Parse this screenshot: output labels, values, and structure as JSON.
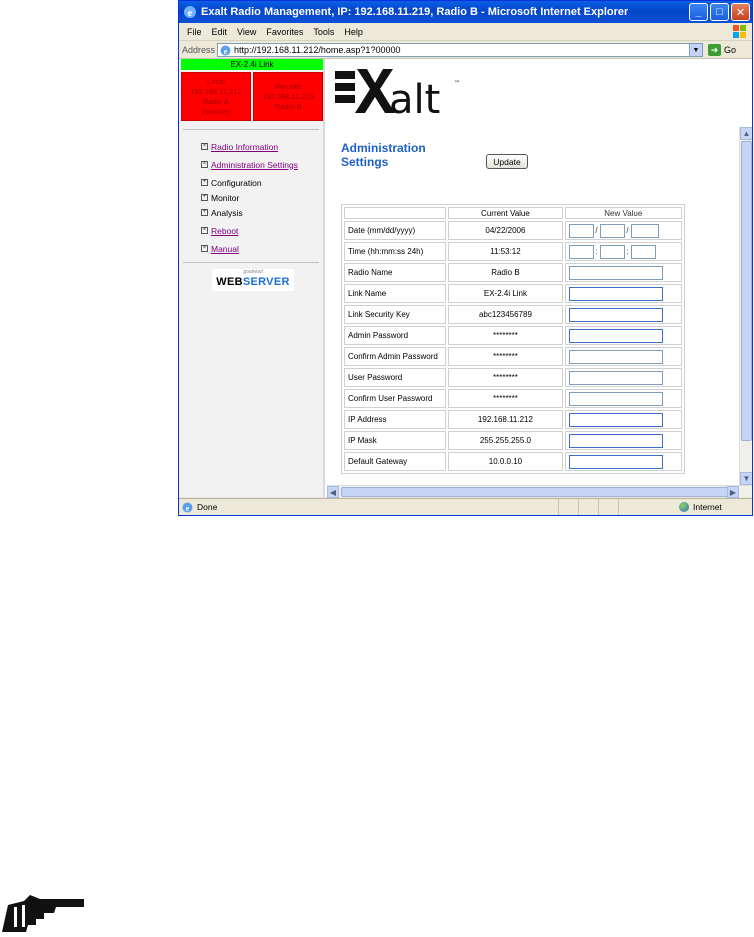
{
  "window": {
    "title": "Exalt Radio Management, IP: 192.168.11.219, Radio B - Microsoft Internet Explorer"
  },
  "menu": {
    "file": "File",
    "edit": "Edit",
    "view": "View",
    "favorites": "Favorites",
    "tools": "Tools",
    "help": "Help"
  },
  "address": {
    "label": "Address",
    "url": "http://192.168.11.212/home.asp?1?00000",
    "go_label": "Go"
  },
  "left": {
    "link_name": "EX-2.4i Link",
    "local_radio": "Local\n192.168.11.212\nRadio A\n(source)",
    "remote_radio": "Remote\n192.168.11.219\nRadio B",
    "nav": [
      {
        "label": "Radio Information"
      },
      {
        "label": "Administration Settings"
      },
      {
        "label": "Configuration"
      },
      {
        "label": "Monitor"
      },
      {
        "label": "Analysis"
      },
      {
        "label": "Reboot"
      },
      {
        "label": "Manual"
      }
    ],
    "webserver": {
      "small": "goahead",
      "web": "WEB",
      "server": "SERVER"
    }
  },
  "main": {
    "logo_text": "alt",
    "title_line1": "Administration",
    "title_line2": "Settings",
    "update_label": "Update",
    "table": {
      "headers": {
        "current": "Current Value",
        "new": "New Value"
      },
      "rows": [
        {
          "label": "Date (mm/dd/yyyy)",
          "current": "04/22/2006"
        },
        {
          "label": "Time (hh:mm:ss 24h)",
          "current": "11:53:12"
        },
        {
          "label": "Radio Name",
          "current": "Radio B"
        },
        {
          "label": "Link Name",
          "current": "EX-2.4i Link"
        },
        {
          "label": "Link Security Key",
          "current": "abc123456789"
        },
        {
          "label": "Admin Password",
          "current": "********"
        },
        {
          "label": "Confirm Admin Password",
          "current": "********"
        },
        {
          "label": "User Password",
          "current": "********"
        },
        {
          "label": "Confirm User Password",
          "current": "********"
        },
        {
          "label": "IP Address",
          "current": "192.168.11.212"
        },
        {
          "label": "IP Mask",
          "current": "255.255.255.0"
        },
        {
          "label": "Default Gateway",
          "current": "10.0.0.10"
        }
      ],
      "date_separator": "/",
      "time_separator": ":"
    }
  },
  "status": {
    "text": "Done",
    "zone": "Internet"
  },
  "colors": {
    "link_green": "#00ff00",
    "radio_red": "#ff0000",
    "title_blue": "#1f5fc9"
  }
}
